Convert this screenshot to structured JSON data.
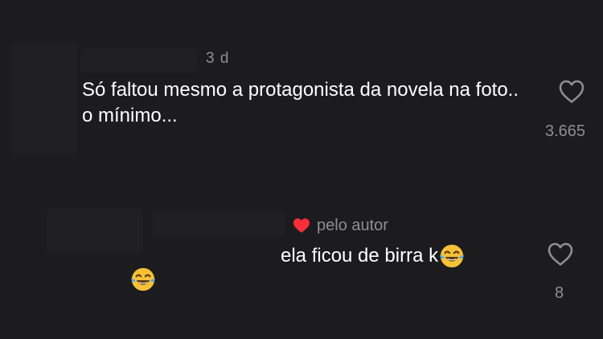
{
  "comment": {
    "time_label": "3 d",
    "text": "Só faltou mesmo a protagonista da novela na foto.. o mínimo...",
    "like_count": "3.665"
  },
  "reply": {
    "author_tag": "pelo autor",
    "text": "ela ficou de birra k",
    "like_count": "8"
  },
  "colors": {
    "background": "#1c1c1e",
    "secondary_text": "#8e8e93",
    "author_heart": "#ff2d3a"
  },
  "icons": [
    "heart-outline-icon",
    "red-heart-icon",
    "tears-of-joy-emoji"
  ]
}
